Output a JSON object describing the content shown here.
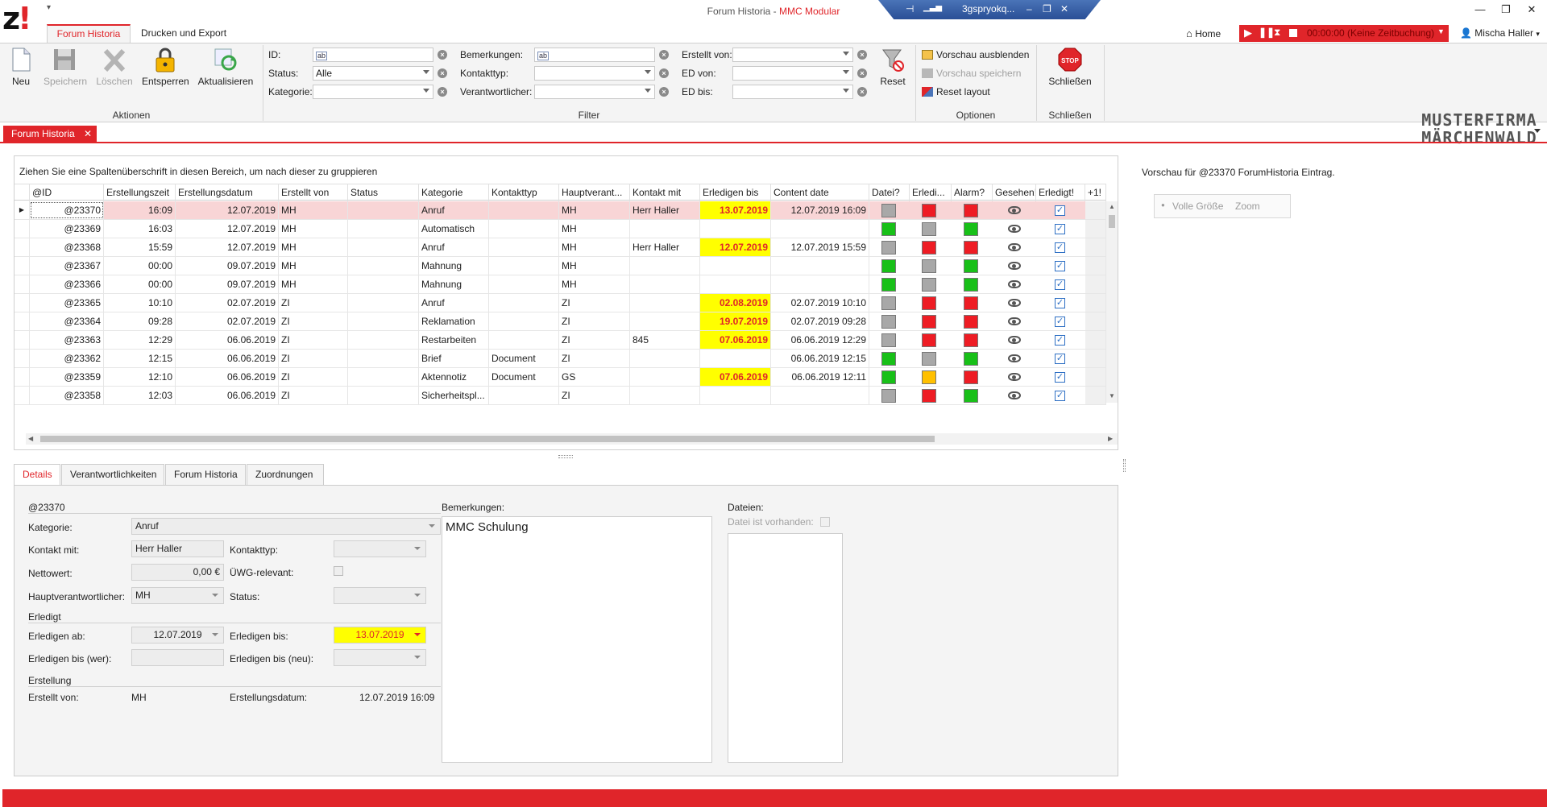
{
  "window": {
    "title_prefix": "Forum Historia - ",
    "title_app": "MMC Modular",
    "logo": "z!",
    "qat": "▾",
    "rdp_host": "3gspryokq...",
    "min": "—",
    "restore": "❐",
    "close": "✕"
  },
  "ribbon": {
    "tabs": [
      "Forum Historia",
      "Drucken und Export"
    ],
    "actions": [
      {
        "label": "Neu",
        "icon": "new-document-icon",
        "enabled": true
      },
      {
        "label": "Speichern",
        "icon": "floppy-disk-icon",
        "enabled": false
      },
      {
        "label": "Löschen",
        "icon": "delete-x-icon",
        "enabled": false
      },
      {
        "label": "Entsperren",
        "icon": "padlock-icon",
        "enabled": true
      },
      {
        "label": "Aktualisieren",
        "icon": "refresh-icon",
        "enabled": true
      }
    ],
    "group_actions": "Aktionen",
    "filter": {
      "id_label": "ID:",
      "id_value": "ab",
      "status_label": "Status:",
      "status_value": "Alle",
      "kategorie_label": "Kategorie:",
      "kategorie_value": "",
      "bemerkungen_label": "Bemerkungen:",
      "bemerkungen_value": "ab",
      "kontakttyp_label": "Kontakttyp:",
      "kontakttyp_value": "",
      "verantwortlicher_label": "Verantwortlicher:",
      "verantwortlicher_value": "",
      "erstellt_label": "Erstellt von:",
      "erstellt_value": "",
      "edvon_label": "ED von:",
      "edvon_value": "",
      "edbis_label": "ED bis:",
      "edbis_value": ""
    },
    "reset_label": "Reset",
    "group_filter": "Filter",
    "options": {
      "vorschau_ausblenden": "Vorschau ausblenden",
      "vorschau_speichern": "Vorschau speichern",
      "reset_layout": "Reset layout"
    },
    "group_optionen": "Optionen",
    "schliessen_label": "Schließen",
    "group_schliessen": "Schließen",
    "stop_text": "STOP"
  },
  "header": {
    "home": "Home",
    "timer_text": "00:00:00 (Keine Zeitbuchung)",
    "user": "Mischa Haller",
    "brand_line1": "MUSTERFIRMA",
    "brand_line2": "MÄRCHENWALD"
  },
  "doc_tab": {
    "label": "Forum Historia",
    "close": "✕"
  },
  "grid": {
    "group_hint": "Ziehen Sie eine Spaltenüberschrift in diesen Bereich, um nach dieser zu gruppieren",
    "columns": [
      "@ID",
      "Erstellungszeit",
      "Erstellungsdatum",
      "Erstellt von",
      "Status",
      "Kategorie",
      "Kontakttyp",
      "Hauptverant...",
      "Kontakt mit",
      "Erledigen bis",
      "Content date",
      "Datei?",
      "Erledi...",
      "Alarm?",
      "Gesehen!",
      "Erledigt!",
      "+1!"
    ],
    "rows": [
      {
        "id": "@23370",
        "zeit": "16:09",
        "datum": "12.07.2019",
        "von": "MH",
        "status": "",
        "kat": "Anruf",
        "typ": "",
        "haupt": "MH",
        "kontakt": "Herr Haller",
        "bis": "13.07.2019",
        "bis_hl": true,
        "content": "12.07.2019 16:09",
        "datei": "gray",
        "erl": "red",
        "alarm": "red",
        "selected": true
      },
      {
        "id": "@23369",
        "zeit": "16:03",
        "datum": "12.07.2019",
        "von": "MH",
        "status": "",
        "kat": "Automatisch",
        "typ": "",
        "haupt": "MH",
        "kontakt": "",
        "bis": "",
        "bis_hl": false,
        "content": "",
        "datei": "green",
        "erl": "gray",
        "alarm": "green",
        "selected": false
      },
      {
        "id": "@23368",
        "zeit": "15:59",
        "datum": "12.07.2019",
        "von": "MH",
        "status": "",
        "kat": "Anruf",
        "typ": "",
        "haupt": "MH",
        "kontakt": "Herr Haller",
        "bis": "12.07.2019",
        "bis_hl": true,
        "content": "12.07.2019 15:59",
        "datei": "gray",
        "erl": "red",
        "alarm": "red",
        "selected": false
      },
      {
        "id": "@23367",
        "zeit": "00:00",
        "datum": "09.07.2019",
        "von": "MH",
        "status": "",
        "kat": "Mahnung",
        "typ": "",
        "haupt": "MH",
        "kontakt": "",
        "bis": "",
        "bis_hl": false,
        "content": "",
        "datei": "green",
        "erl": "gray",
        "alarm": "green",
        "selected": false
      },
      {
        "id": "@23366",
        "zeit": "00:00",
        "datum": "09.07.2019",
        "von": "MH",
        "status": "",
        "kat": "Mahnung",
        "typ": "",
        "haupt": "MH",
        "kontakt": "",
        "bis": "",
        "bis_hl": false,
        "content": "",
        "datei": "green",
        "erl": "gray",
        "alarm": "green",
        "selected": false
      },
      {
        "id": "@23365",
        "zeit": "10:10",
        "datum": "02.07.2019",
        "von": "ZI",
        "status": "",
        "kat": "Anruf",
        "typ": "",
        "haupt": "ZI",
        "kontakt": "",
        "bis": "02.08.2019",
        "bis_hl": true,
        "content": "02.07.2019 10:10",
        "datei": "gray",
        "erl": "red",
        "alarm": "red",
        "selected": false
      },
      {
        "id": "@23364",
        "zeit": "09:28",
        "datum": "02.07.2019",
        "von": "ZI",
        "status": "",
        "kat": "Reklamation",
        "typ": "",
        "haupt": "ZI",
        "kontakt": "",
        "bis": "19.07.2019",
        "bis_hl": true,
        "content": "02.07.2019 09:28",
        "datei": "gray",
        "erl": "red",
        "alarm": "red",
        "selected": false
      },
      {
        "id": "@23363",
        "zeit": "12:29",
        "datum": "06.06.2019",
        "von": "ZI",
        "status": "",
        "kat": "Restarbeiten",
        "typ": "",
        "haupt": "ZI",
        "kontakt": "845",
        "bis": "07.06.2019",
        "bis_hl": true,
        "content": "06.06.2019 12:29",
        "datei": "gray",
        "erl": "red",
        "alarm": "red",
        "selected": false
      },
      {
        "id": "@23362",
        "zeit": "12:15",
        "datum": "06.06.2019",
        "von": "ZI",
        "status": "",
        "kat": "Brief",
        "typ": "Document",
        "haupt": "ZI",
        "kontakt": "",
        "bis": "",
        "bis_hl": false,
        "content": "06.06.2019 12:15",
        "datei": "green",
        "erl": "gray",
        "alarm": "green",
        "selected": false
      },
      {
        "id": "@23359",
        "zeit": "12:10",
        "datum": "06.06.2019",
        "von": "ZI",
        "status": "",
        "kat": "Aktennotiz",
        "typ": "Document",
        "haupt": "GS",
        "kontakt": "",
        "bis": "07.06.2019",
        "bis_hl": true,
        "content": "06.06.2019 12:11",
        "datei": "green",
        "erl": "yellow",
        "alarm": "red",
        "selected": false
      },
      {
        "id": "@23358",
        "zeit": "12:03",
        "datum": "06.06.2019",
        "von": "ZI",
        "status": "",
        "kat": "Sicherheitspl...",
        "typ": "",
        "haupt": "ZI",
        "kontakt": "",
        "bis": "",
        "bis_hl": false,
        "content": "",
        "datei": "gray",
        "erl": "red",
        "alarm": "green",
        "selected": false
      }
    ]
  },
  "details": {
    "tabs": [
      "Details",
      "Verantwortlichkeiten",
      "Forum Historia",
      "Zuordnungen"
    ],
    "id": "@23370",
    "kategorie_label": "Kategorie:",
    "kategorie": "Anruf",
    "kontakt_label": "Kontakt mit:",
    "kontakt": "Herr Haller",
    "kontakttyp_label": "Kontakttyp:",
    "kontakttyp": "",
    "netto_label": "Nettowert:",
    "netto": "0,00 €",
    "uewg_label": "ÜWG-relevant:",
    "haupt_label": "Hauptverantwortlicher:",
    "haupt": "MH",
    "status_label": "Status:",
    "status": "",
    "erledigt_section": "Erledigt",
    "ab_label": "Erledigen ab:",
    "ab": "12.07.2019",
    "bis_label": "Erledigen bis:",
    "bis": "13.07.2019",
    "biswer_label": "Erledigen bis (wer):",
    "biswer": "",
    "bisneu_label": "Erledigen bis (neu):",
    "bisneu": "",
    "erstellung_section": "Erstellung",
    "erstelltvon_label": "Erstellt von:",
    "erstelltvon": "MH",
    "edatum_label": "Erstellungsdatum:",
    "edatum": "12.07.2019 16:09",
    "bemerkungen_label": "Bemerkungen:",
    "bemerkungen": "MMC Schulung",
    "dateien_label": "Dateien:",
    "datei_vorhanden_label": "Datei ist vorhanden:"
  },
  "preview": {
    "title": "Vorschau für @23370 ForumHistoria Eintrag.",
    "volle": "Volle Größe",
    "zoom": "Zoom"
  }
}
